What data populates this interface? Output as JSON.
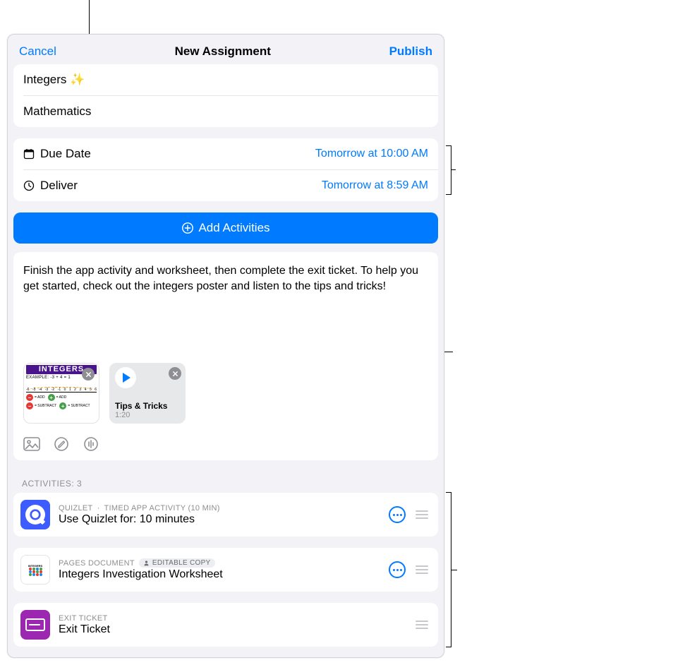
{
  "header": {
    "cancel": "Cancel",
    "title": "New Assignment",
    "publish": "Publish"
  },
  "fields": {
    "name": "Integers ✨",
    "class": "Mathematics"
  },
  "schedule": {
    "due_label": "Due Date",
    "due_value": "Tomorrow at 10:00 AM",
    "deliver_label": "Deliver",
    "deliver_value": "Tomorrow at 8:59 AM"
  },
  "add_activities_label": "Add Activities",
  "instructions": "Finish the app activity and worksheet, then complete the exit ticket. To help you get started, check out the integers poster and listen to the tips and tricks!",
  "attachments": {
    "poster": {
      "title": "INTEGERS",
      "example_label": "EXAMPLE: -3 + 4 = 1",
      "axis_labels": [
        "-6",
        "-5",
        "-4",
        "-3",
        "-2",
        "-1",
        "0",
        "1",
        "2",
        "3",
        "4",
        "5",
        "6"
      ],
      "keys": [
        {
          "symbol": "−",
          "color": "r",
          "text": "= ADD"
        },
        {
          "symbol": "+",
          "color": "g",
          "text": "= ADD"
        },
        {
          "symbol": "−",
          "color": "r",
          "text": "= SUBTRACT"
        },
        {
          "symbol": "+",
          "color": "g",
          "text": "= SUBTRACT"
        }
      ]
    },
    "audio": {
      "title": "Tips & Tricks",
      "duration": "1:20"
    }
  },
  "activities_header": "ACTIVITIES: 3",
  "activities": [
    {
      "app": "QUIZLET",
      "meta": "TIMED APP ACTIVITY (10 MIN)",
      "title": "Use Quizlet for: 10 minutes",
      "thumb": "quizlet",
      "has_more": true
    },
    {
      "app": "PAGES DOCUMENT",
      "badge": "EDITABLE COPY",
      "title": "Integers Investigation Worksheet",
      "thumb": "pages",
      "has_more": true
    },
    {
      "app": "EXIT TICKET",
      "title": "Exit Ticket",
      "thumb": "exit",
      "has_more": false
    }
  ]
}
